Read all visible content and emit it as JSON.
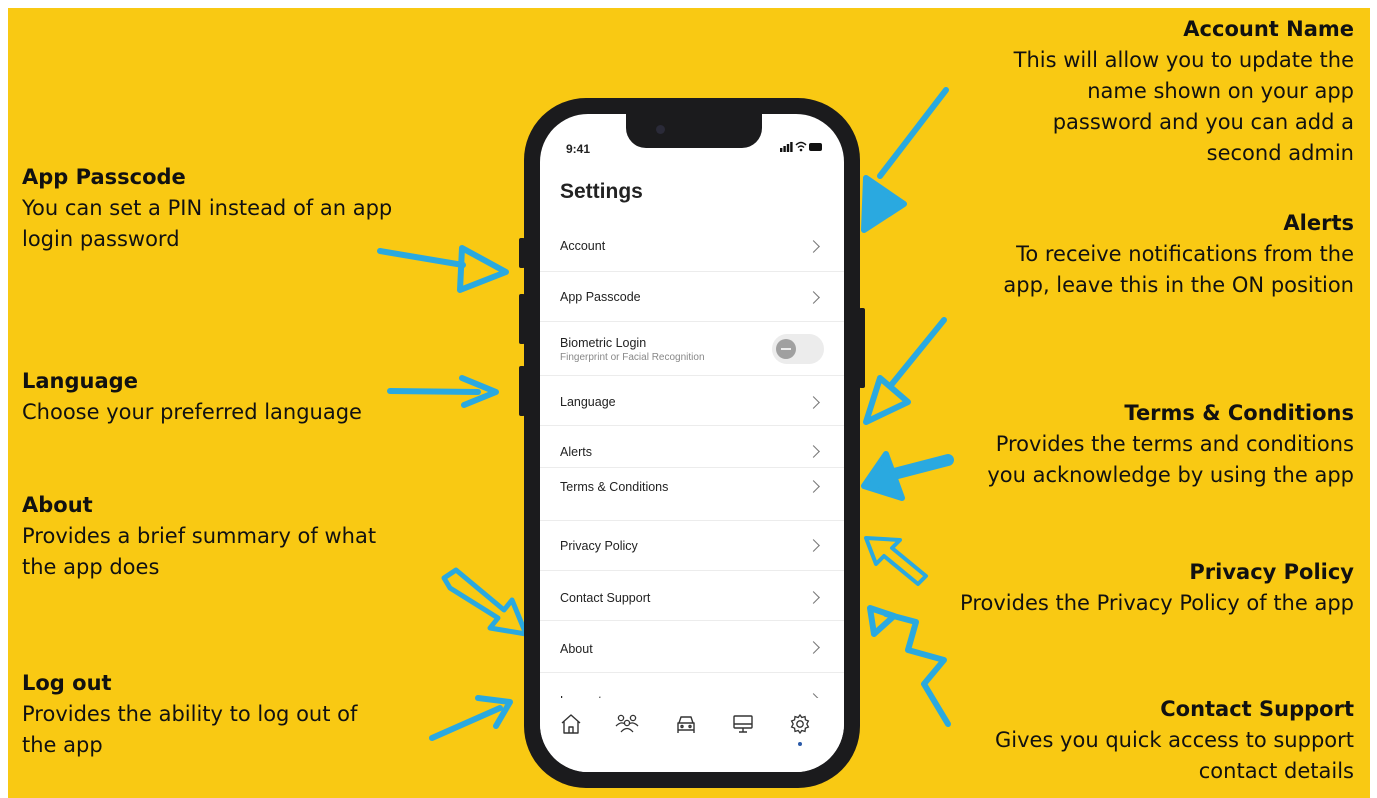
{
  "phone": {
    "status_time": "9:41",
    "screen_title": "Settings",
    "rows": [
      {
        "label": "Account"
      },
      {
        "label": "App Passcode"
      },
      {
        "label": "Biometric Login",
        "sublabel": "Fingerprint or Facial Recognition",
        "toggle": "off"
      },
      {
        "label": "Language"
      },
      {
        "label": "Alerts"
      },
      {
        "label": "Terms & Conditions"
      },
      {
        "label": "Privacy Policy"
      },
      {
        "label": "Contact Support"
      },
      {
        "label": "About"
      },
      {
        "label": "Log out"
      }
    ],
    "tab_icons": [
      "home-icon",
      "people-icon",
      "car-icon",
      "monitor-icon",
      "gear-icon"
    ],
    "active_tab": "gear-icon"
  },
  "annotations_left": [
    {
      "heading": "App Passcode",
      "body": [
        "You can set a PIN instead of an app",
        "login password"
      ]
    },
    {
      "heading": "Language",
      "body": [
        "Choose your preferred language"
      ]
    },
    {
      "heading": "About",
      "body": [
        "Provides a brief summary of what",
        "the app does"
      ]
    },
    {
      "heading": "Log out",
      "body": [
        "Provides the ability to log out of",
        "the app"
      ]
    }
  ],
  "annotations_right": [
    {
      "heading": "Account Name",
      "body": [
        "This will allow you to update the",
        "name shown on your app",
        "password and you can add a",
        "second admin"
      ]
    },
    {
      "heading": "Alerts",
      "body": [
        "To receive notifications from the",
        "app, leave this in the ON position"
      ]
    },
    {
      "heading": "Terms & Conditions",
      "body": [
        "Provides the terms and conditions",
        "you acknowledge by using the app"
      ]
    },
    {
      "heading": "Privacy Policy",
      "body": [
        "Provides the Privacy Policy of the app"
      ]
    },
    {
      "heading": "Contact Support",
      "body": [
        "Gives you quick access to support",
        "contact details"
      ]
    }
  ],
  "colors": {
    "background": "#f9c913",
    "arrow": "#2aa9e0",
    "phone_frame": "#1b1b1d",
    "active_dot": "#2b5aa8"
  }
}
